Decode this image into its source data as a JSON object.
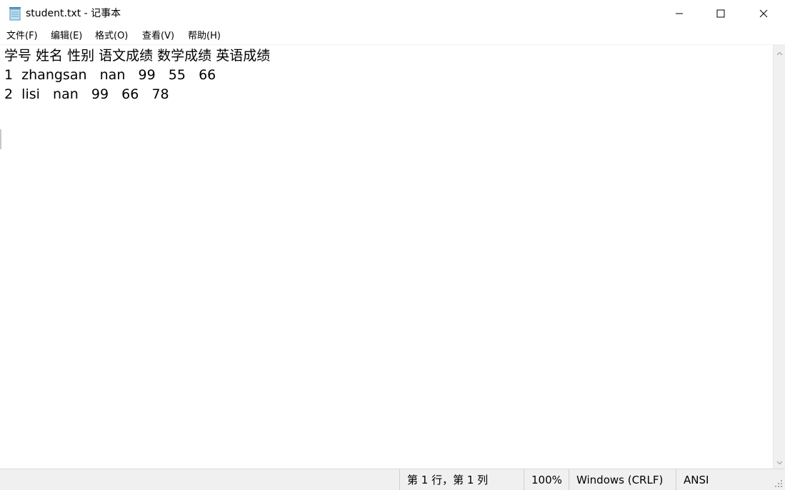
{
  "window": {
    "title": "student.txt - 记事本",
    "app_icon": "notepad-icon",
    "controls": [
      "minimize-icon",
      "maximize-icon",
      "close-icon"
    ]
  },
  "menu": {
    "file": "文件(F)",
    "edit": "编辑(E)",
    "format": "格式(O)",
    "view": "查看(V)",
    "help": "帮助(H)"
  },
  "document": {
    "lines": [
      "学号 姓名 性别 语文成绩 数学成绩 英语成绩",
      "1  zhangsan   nan   99   55   66",
      "2  lisi   nan   99   66   78"
    ]
  },
  "status": {
    "position": "第 1 行，第 1 列",
    "zoom": "100%",
    "line_ending": "Windows (CRLF)",
    "encoding": "ANSI"
  },
  "colors": {
    "background": "#ffffff",
    "statusbar": "#f0f0f0",
    "scrollbar": "#f0f0f0"
  }
}
